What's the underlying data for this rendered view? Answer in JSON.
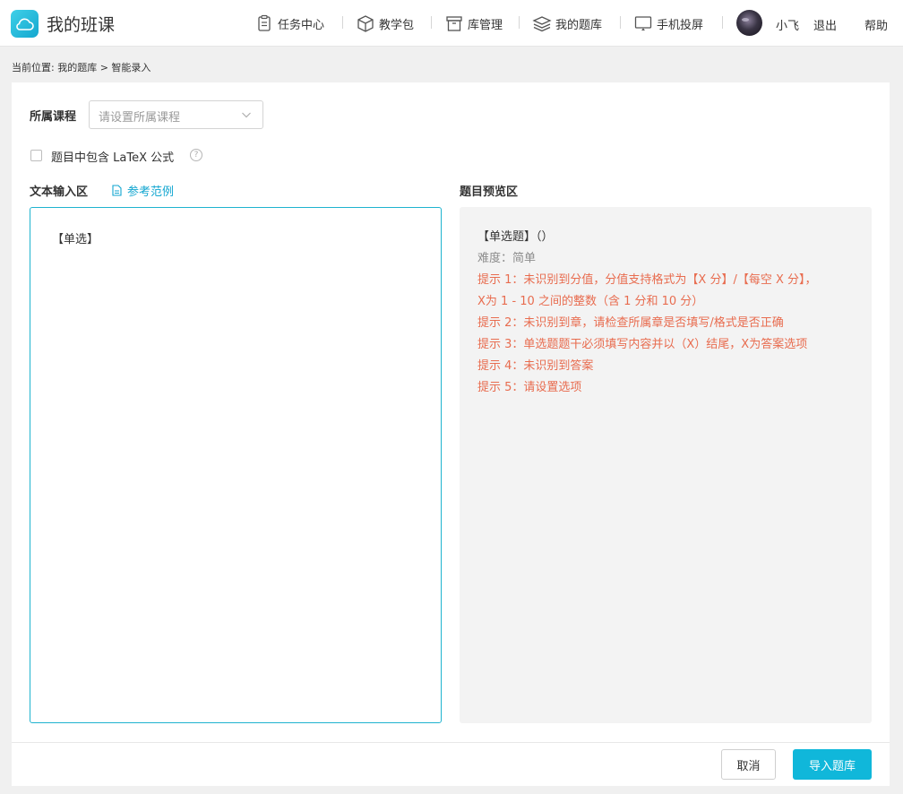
{
  "header": {
    "brand": "我的班课",
    "nav": [
      {
        "label": "任务中心",
        "icon": "clipboard-icon"
      },
      {
        "label": "教学包",
        "icon": "box-icon"
      },
      {
        "label": "库管理",
        "icon": "archive-icon"
      },
      {
        "label": "我的题库",
        "icon": "layers-icon"
      },
      {
        "label": "手机投屏",
        "icon": "monitor-icon"
      }
    ],
    "user_name": "小飞",
    "logout": "退出",
    "help": "帮助"
  },
  "breadcrumb": "当前位置: 我的题库 > 智能录入",
  "form": {
    "course_label": "所属课程",
    "course_placeholder": "请设置所属课程",
    "latex_label": "题目中包含 LaTeX 公式",
    "latex_checked": false,
    "help_glyph": "?"
  },
  "input_area": {
    "title": "文本输入区",
    "reference_link": "参考范例",
    "content": "【单选】"
  },
  "preview_area": {
    "title": "题目预览区",
    "question": "【单选题】（）",
    "difficulty": "难度：简单",
    "tips": [
      "提示 1：未识别到分值，分值支持格式为【X 分】/【每空 X 分】，",
      "X为 1 - 10 之间的整数（含 1 分和 10 分）",
      "提示 2：未识别到章，请检查所属章是否填写/格式是否正确",
      "提示 3：单选题题干必须填写内容并以（X）结尾，X为答案选项",
      "提示 4：未识别到答案",
      "提示 5：请设置选项"
    ],
    "tip_color": "#e86c4f"
  },
  "footer": {
    "cancel": "取消",
    "import": "导入题库",
    "accent": "#10b7da"
  }
}
